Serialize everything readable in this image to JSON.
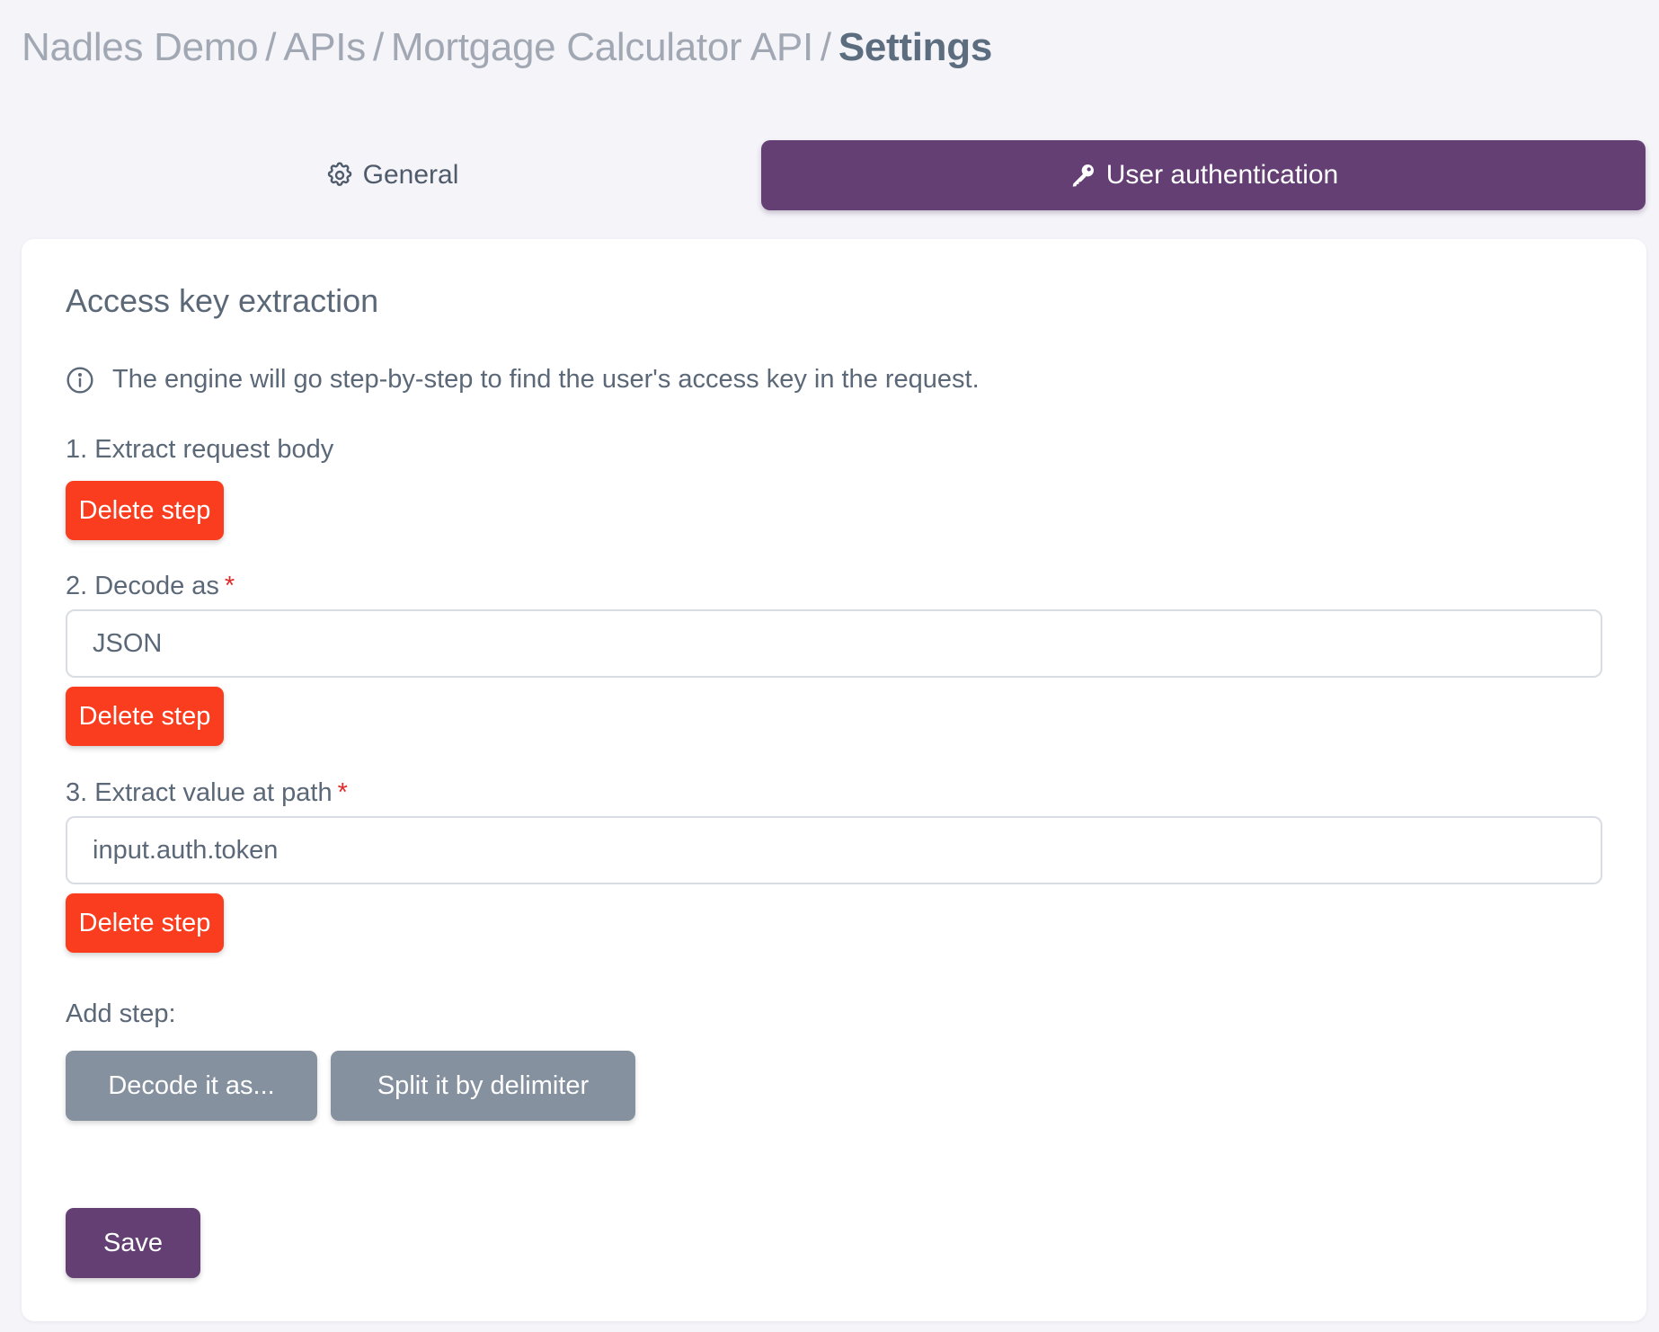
{
  "breadcrumb": {
    "items": [
      "Nadles Demo",
      "APIs",
      "Mortgage Calculator API"
    ],
    "separator": "/",
    "current": "Settings"
  },
  "tabs": [
    {
      "label": "General",
      "icon": "gear-icon",
      "active": false
    },
    {
      "label": "User authentication",
      "icon": "key-icon",
      "active": true
    }
  ],
  "section": {
    "title": "Access key extraction",
    "info_text": "The engine will go step-by-step to find the user's access key in the request.",
    "info_icon": "info-icon"
  },
  "steps": [
    {
      "label": "1. Extract request body",
      "required": false,
      "delete_label": "Delete step"
    },
    {
      "label": "2. Decode as",
      "required": true,
      "value": "JSON",
      "delete_label": "Delete step"
    },
    {
      "label": "3. Extract value at path",
      "required": true,
      "value": "input.auth.token",
      "delete_label": "Delete step"
    }
  ],
  "required_marker": "*",
  "add_step": {
    "label": "Add step:",
    "options": [
      "Decode it as...",
      "Split it by delimiter"
    ]
  },
  "save_label": "Save",
  "colors": {
    "accent": "#643f73",
    "danger": "#fb3d1f",
    "secondary": "#85919f",
    "background": "#f4f4f9"
  }
}
